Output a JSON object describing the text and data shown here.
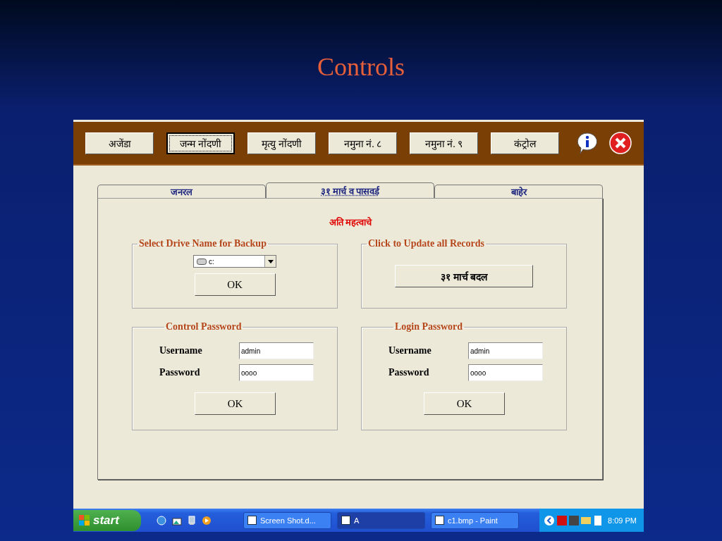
{
  "slide": {
    "title": "Controls"
  },
  "toolbar": {
    "buttons": [
      {
        "label": "अजेंडा",
        "selected": false
      },
      {
        "label": "जन्म नोंदणी",
        "selected": true
      },
      {
        "label": "मृत्यु नोंदणी",
        "selected": false
      },
      {
        "label": "नमुना नं. ८",
        "selected": false
      },
      {
        "label": "नमुना नं. ९",
        "selected": false
      },
      {
        "label": "कंट्रोल",
        "selected": false
      }
    ]
  },
  "tabs": [
    {
      "label": "जनरल",
      "selected": false
    },
    {
      "label": "३१ मार्च व पासवर्ड",
      "selected": true
    },
    {
      "label": "बाहेर",
      "selected": false
    }
  ],
  "notice": "अति महत्वाचे",
  "backup": {
    "legend": "Select Drive Name for Backup",
    "drive": "c:",
    "button": "OK"
  },
  "update": {
    "legend": "Click to Update all Records",
    "button": "३१ मार्च बदल"
  },
  "password_groups": [
    {
      "legend": "Control Password",
      "fields": [
        {
          "label": "Username",
          "value": "admin"
        },
        {
          "label": "Password",
          "value": "oooo"
        }
      ],
      "button": "OK"
    },
    {
      "legend": "Login Password",
      "fields": [
        {
          "label": "Username",
          "value": "admin"
        },
        {
          "label": "Password",
          "value": "oooo"
        }
      ],
      "button": "OK"
    }
  ],
  "taskbar": {
    "start": "start",
    "tasks": [
      {
        "label": "Screen Shot.d...",
        "selected": false
      },
      {
        "label": "A",
        "selected": true
      },
      {
        "label": "c1.bmp - Paint",
        "selected": false
      }
    ],
    "clock": "8:09 PM"
  }
}
